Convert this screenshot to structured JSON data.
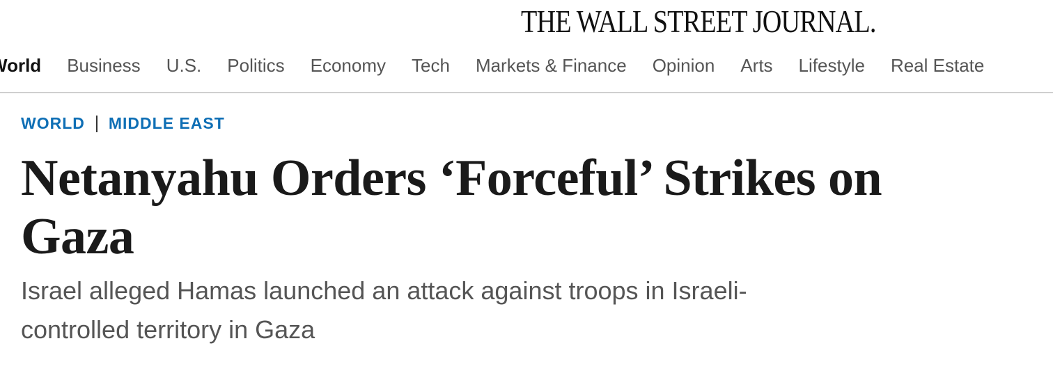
{
  "masthead": {
    "title": "THE WALL STREET JOURNAL."
  },
  "nav": {
    "items": [
      {
        "label": "World",
        "active": true
      },
      {
        "label": "Business",
        "active": false
      },
      {
        "label": "U.S.",
        "active": false
      },
      {
        "label": "Politics",
        "active": false
      },
      {
        "label": "Economy",
        "active": false
      },
      {
        "label": "Tech",
        "active": false
      },
      {
        "label": "Markets & Finance",
        "active": false
      },
      {
        "label": "Opinion",
        "active": false
      },
      {
        "label": "Arts",
        "active": false
      },
      {
        "label": "Lifestyle",
        "active": false
      },
      {
        "label": "Real Estate",
        "active": false
      }
    ]
  },
  "breadcrumb": {
    "section": "WORLD",
    "subsection": "MIDDLE EAST"
  },
  "article": {
    "headline": "Netanyahu Orders ‘Forceful’ Strikes on Gaza",
    "dek": "Israel alleged Hamas launched an attack against troops in Israeli-controlled territory in Gaza"
  },
  "colors": {
    "breadcrumb_link": "#0f6fb5",
    "nav_text": "#555555",
    "nav_active": "#111111",
    "headline": "#1a1a1a",
    "dek": "#555555",
    "rule": "#cfcfcf"
  }
}
